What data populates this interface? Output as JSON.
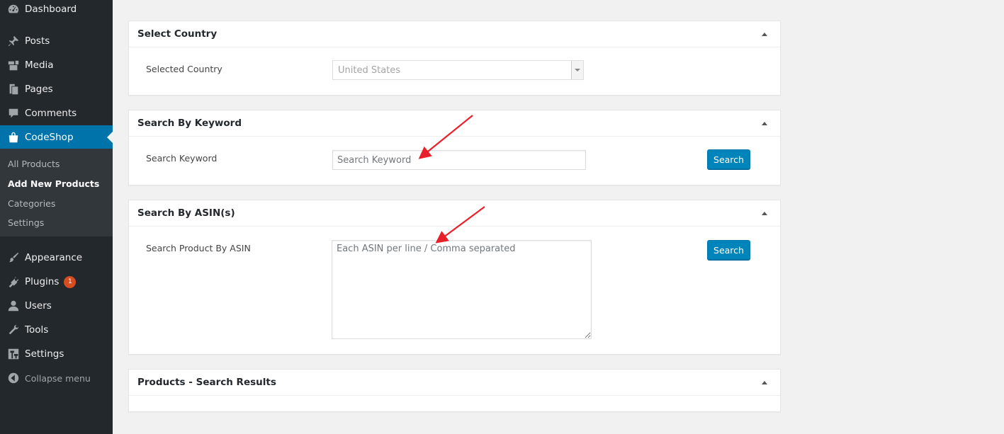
{
  "sidebar": {
    "items": [
      {
        "label": "Dashboard",
        "icon": "dashboard-icon"
      },
      {
        "label": "Posts",
        "icon": "pin-icon"
      },
      {
        "label": "Media",
        "icon": "media-icon"
      },
      {
        "label": "Pages",
        "icon": "pages-icon"
      },
      {
        "label": "Comments",
        "icon": "comment-icon"
      },
      {
        "label": "CodeShop",
        "icon": "shop-bag-icon",
        "active": true
      },
      {
        "label": "Appearance",
        "icon": "brush-icon"
      },
      {
        "label": "Plugins",
        "icon": "plug-icon",
        "badge": "1"
      },
      {
        "label": "Users",
        "icon": "user-icon"
      },
      {
        "label": "Tools",
        "icon": "wrench-icon"
      },
      {
        "label": "Settings",
        "icon": "settings-icon"
      }
    ],
    "submenu": [
      {
        "label": "All Products"
      },
      {
        "label": "Add New Products",
        "current": true
      },
      {
        "label": "Categories"
      },
      {
        "label": "Settings"
      }
    ],
    "collapse_label": "Collapse menu"
  },
  "panels": {
    "country": {
      "title": "Select Country",
      "field_label": "Selected Country",
      "selected_value": "United States"
    },
    "keyword": {
      "title": "Search By Keyword",
      "field_label": "Search Keyword",
      "placeholder": "Search Keyword",
      "button_label": "Search"
    },
    "asin": {
      "title": "Search By ASIN(s)",
      "field_label": "Search Product By ASIN",
      "placeholder": "Each ASIN per line / Comma separated",
      "button_label": "Search"
    },
    "results": {
      "title": "Products - Search Results"
    }
  },
  "colors": {
    "sidebar_bg": "#23282d",
    "submenu_bg": "#32373c",
    "accent": "#0073aa",
    "button": "#0085ba",
    "badge": "#d54e21",
    "annotation": "#e8202a"
  }
}
